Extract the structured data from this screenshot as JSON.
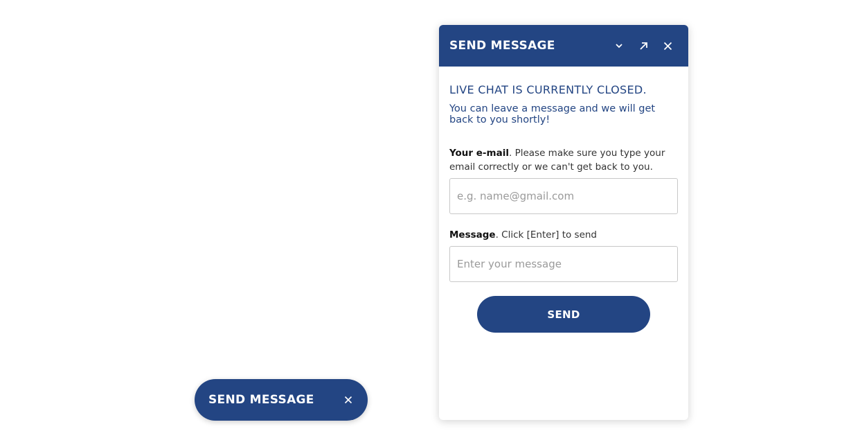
{
  "chat": {
    "title": "SEND MESSAGE",
    "icons": [
      "chevron-down-icon",
      "popout-arrow-icon",
      "close-icon"
    ],
    "closed_title": "LIVE CHAT IS CURRENTLY CLOSED.",
    "closed_subtitle": "You can leave a message and we will get back to you shortly!",
    "email_label_bold": "Your e-mail",
    "email_label_rest": ". Please make sure you type your email correctly or we can't get back to you.",
    "email_placeholder": "e.g. name@gmail.com",
    "message_label_bold": "Message",
    "message_label_rest": ". Click [Enter] to send",
    "message_placeholder": "Enter your message",
    "send_label": "SEND"
  },
  "launcher": {
    "label": "SEND MESSAGE",
    "icon": "close-icon"
  },
  "colors": {
    "brand": "#234583",
    "background": "#ffffff",
    "input_border": "#c8c8c8"
  }
}
